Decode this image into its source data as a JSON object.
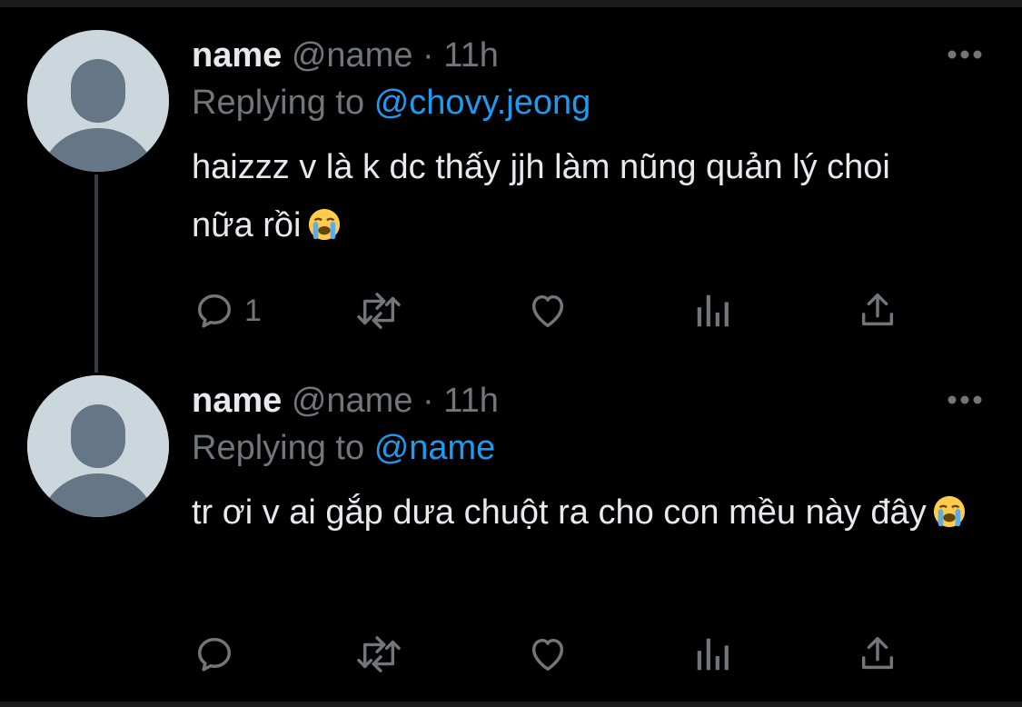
{
  "tweets": [
    {
      "name": "name",
      "handle": "@name",
      "dot": "·",
      "time": "11h",
      "replying_prefix": "Replying to",
      "replying_to": "@chovy.jeong",
      "text": "haizzz v là k dc thấy jjh làm nũng quản lý choi nữa rồi",
      "emoji": "loudly-crying-face",
      "reply_count": "1"
    },
    {
      "name": "name",
      "handle": "@name",
      "dot": "·",
      "time": "11h",
      "replying_prefix": "Replying to",
      "replying_to": "@name",
      "text": "tr ơi v ai gắp dưa chuột ra cho con mều này đây",
      "emoji": "loudly-crying-face",
      "reply_count": ""
    }
  ],
  "colors": {
    "background": "#000000",
    "text_primary": "#e7e9ea",
    "text_secondary": "#71767b",
    "accent": "#1d9bf0",
    "avatar_bg": "#ccd6dd",
    "avatar_fg": "#657786"
  },
  "icons": {
    "reply": "reply-icon",
    "retweet": "retweet-icon",
    "like": "heart-icon",
    "analytics": "analytics-icon",
    "share": "share-icon",
    "more": "more-options-icon"
  }
}
